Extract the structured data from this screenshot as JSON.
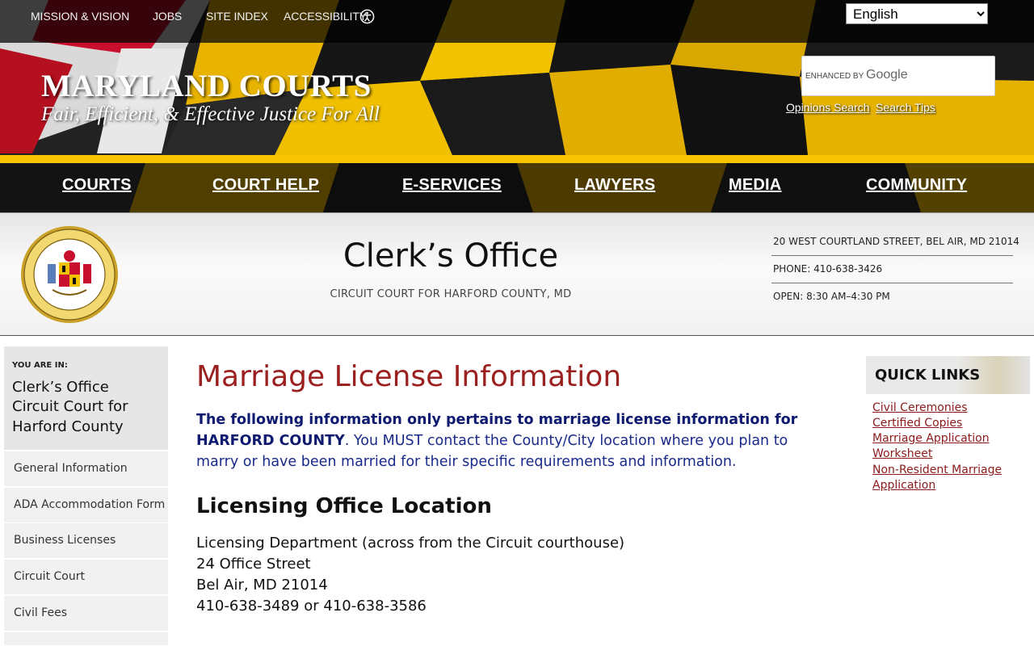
{
  "utility_nav": {
    "mission": "MISSION & VISION",
    "jobs": "JOBS",
    "site_index": "SITE INDEX",
    "accessibility": "ACCESSIBILITY"
  },
  "language": {
    "selected": "English"
  },
  "brand": {
    "title": "MARYLAND COURTS",
    "tagline": "Fair, Efficient, & Effective Justice For All"
  },
  "search": {
    "enhanced_by": "ENHANCED BY",
    "google": "Google",
    "opinions_search": "Opinions Search",
    "search_tips": "Search Tips"
  },
  "main_nav": [
    "COURTS",
    "COURT HELP",
    "E-SERVICES",
    "LAWYERS",
    "MEDIA",
    "COMMUNITY"
  ],
  "court": {
    "title": "Clerk’s Office",
    "subtitle": "CIRCUIT COURT FOR HARFORD COUNTY, MD",
    "address": "20 WEST COURTLAND STREET, BEL AIR, MD 21014",
    "phone": "PHONE: 410-638-3426",
    "hours": "OPEN: 8:30 AM–4:30 PM"
  },
  "sidebar": {
    "you_are_in": "YOU ARE IN:",
    "location_lines": [
      "Clerk’s Office",
      "Circuit Court for",
      "Harford County"
    ],
    "items": [
      "General Information",
      "ADA Accommodation Form",
      "Business Licenses",
      "Circuit Court",
      "Civil Fees"
    ]
  },
  "main": {
    "title": "Marriage License Information",
    "intro_bold": "The following information only pertains to marriage license information for HARFORD COUNTY",
    "intro_rest": ". You MUST contact the County/City location where you plan to marry or have been married for their specific requirements and information.",
    "location_heading": "Licensing Office Location",
    "address_lines": [
      "Licensing Department (across from the Circuit courthouse)",
      "24 Office Street",
      "Bel Air, MD 21014",
      "410-638-3489 or 410-638-3586"
    ]
  },
  "quick_links": {
    "heading": "QUICK LINKS",
    "lines": [
      "Civil Ceremonies",
      "Certified Copies",
      "Marriage Application",
      "Worksheet",
      "Non-Resident Marriage",
      "Application"
    ]
  },
  "colors": {
    "flag_yellow": "#f6c400",
    "title_red": "#9b2020",
    "intro_blue": "#1a2a8a",
    "link_red": "#8b1a1a"
  }
}
